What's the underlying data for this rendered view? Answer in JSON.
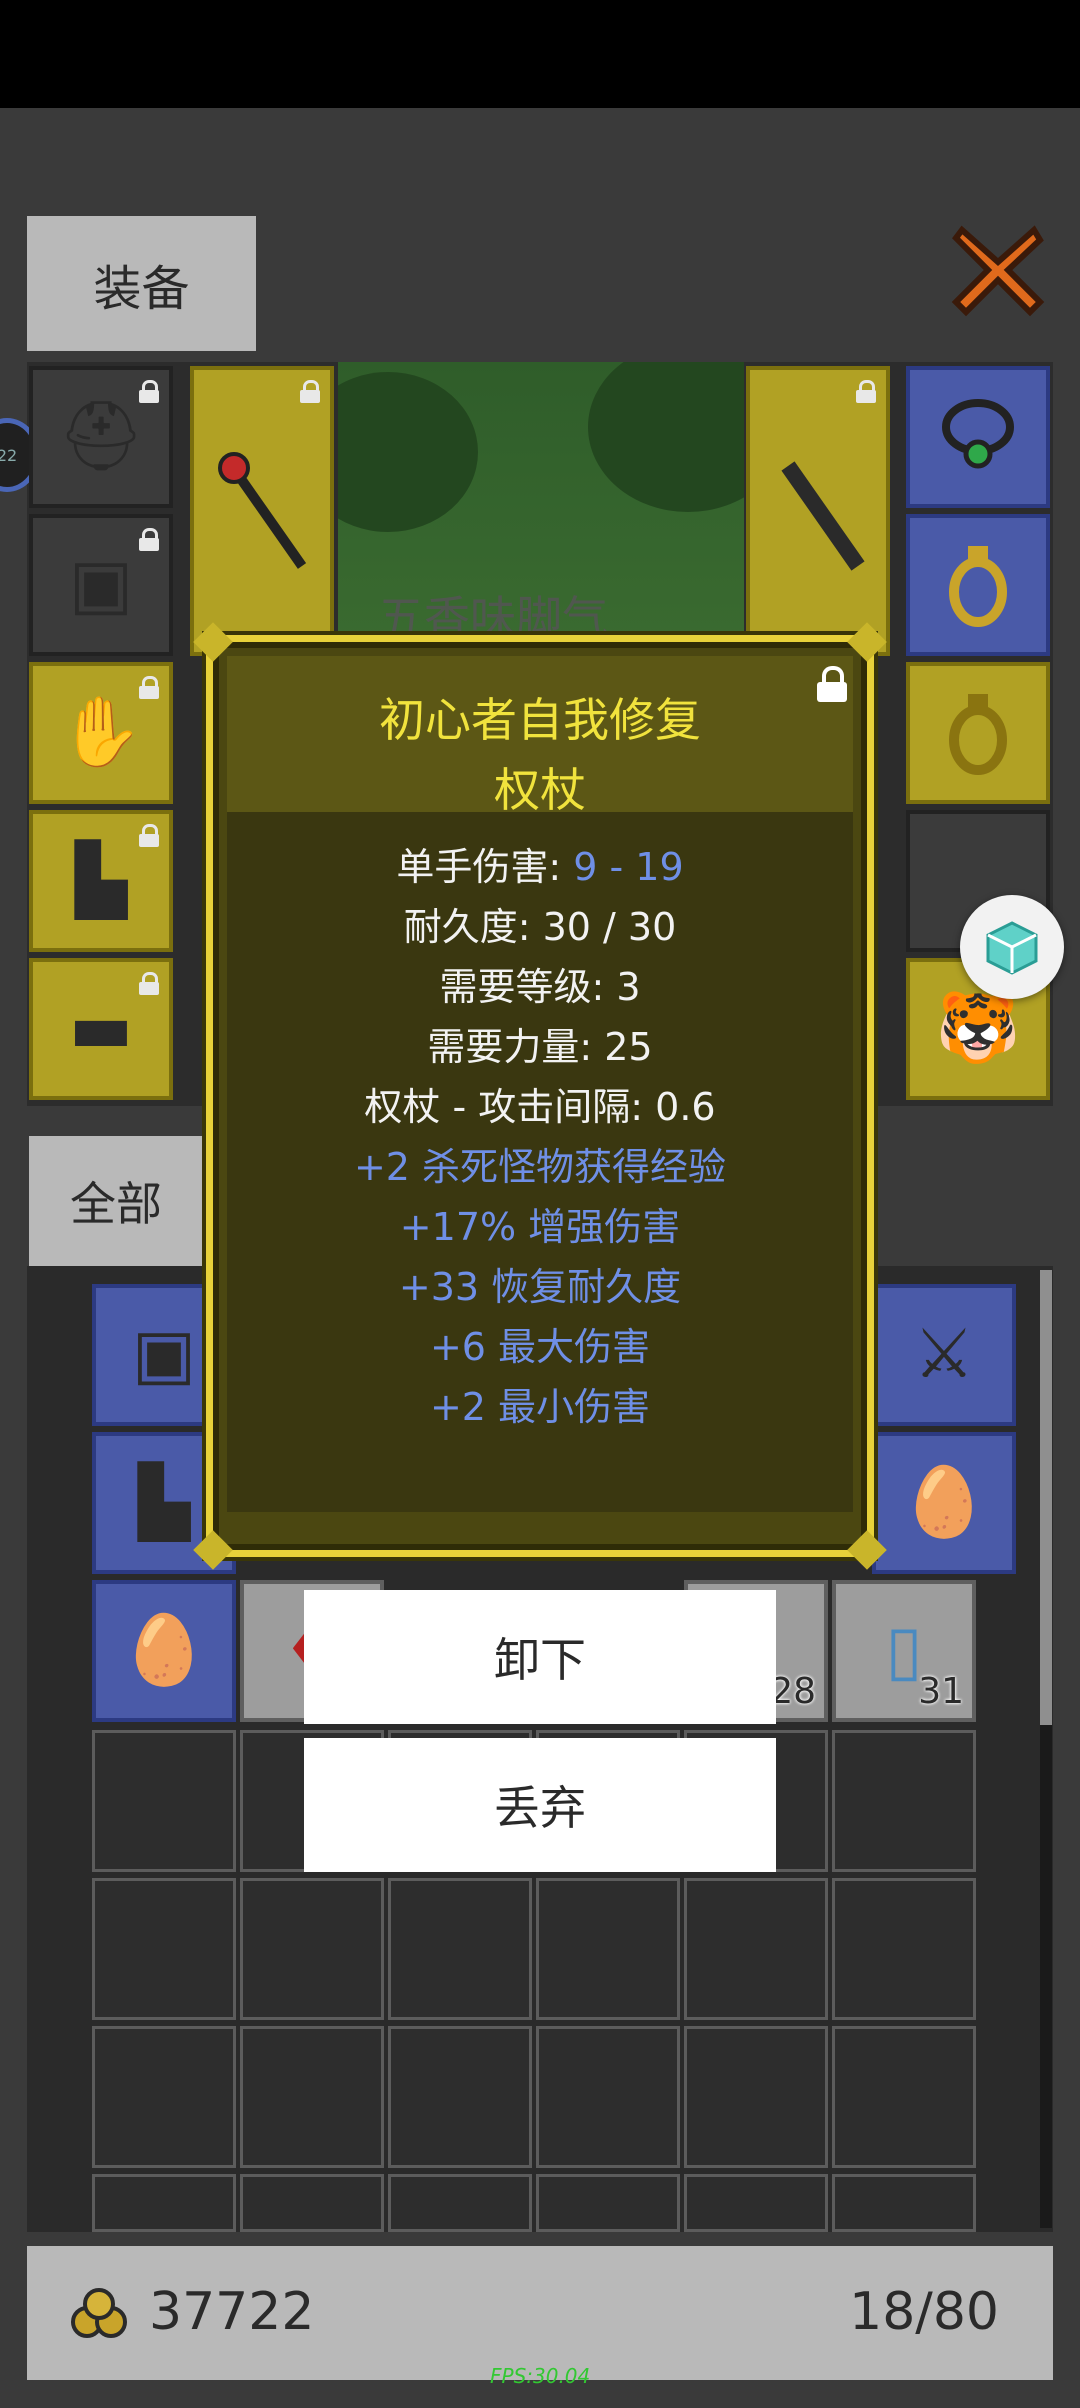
{
  "tabs": {
    "equipment_label": "装备",
    "all_label": "全部"
  },
  "scene": {
    "banner_text": "五香味脚气"
  },
  "side_bubble": "22",
  "tooltip": {
    "title_line1": "初心者自我修复",
    "title_line2": "权杖",
    "damage_label": "单手伤害: ",
    "damage_value": "9 - 19",
    "durability": "耐久度: 30 / 30",
    "req_level": "需要等级: 3",
    "req_strength": "需要力量: 25",
    "attack_interval": "权杖 - 攻击间隔: 0.6",
    "affixes": [
      "+2 杀死怪物获得经验",
      "+17% 增强伤害",
      "+33 恢复耐久度",
      "+6 最大伤害",
      "+2 最小伤害"
    ]
  },
  "actions": {
    "unequip_label": "卸下",
    "discard_label": "丢弃"
  },
  "inventory": {
    "counts": [
      "28",
      "31"
    ],
    "gold": "37722",
    "capacity": "18/80"
  },
  "fps": "FPS:30.04",
  "colors": {
    "gold_slot": "#b1a124",
    "blue_slot": "#4a5aa8",
    "tooltip_border": "#e8d23a",
    "affix_blue": "#6f8fe6"
  },
  "icons": [
    "close-x-icon",
    "lock-icon",
    "coin-pile-icon",
    "cube-icon"
  ]
}
